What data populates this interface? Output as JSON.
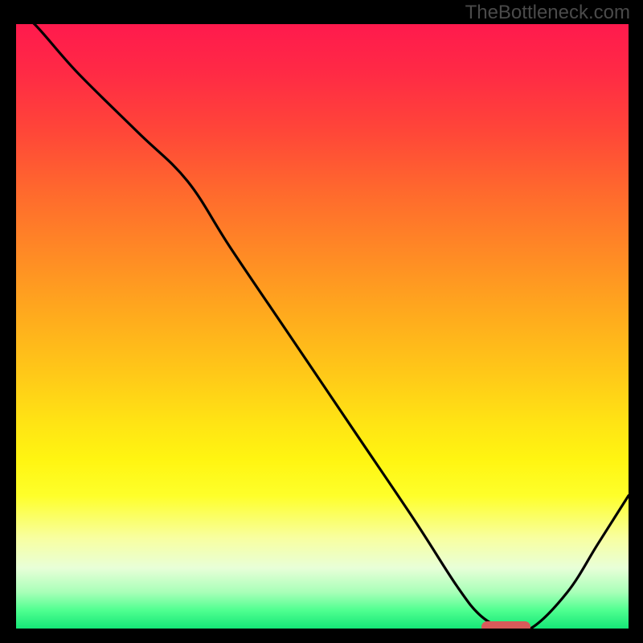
{
  "watermark": "TheBottleneck.com",
  "chart_data": {
    "type": "line",
    "title": "",
    "xlabel": "",
    "ylabel": "",
    "xlim": [
      0,
      100
    ],
    "ylim": [
      0,
      100
    ],
    "x": [
      0,
      3,
      10,
      20,
      28,
      35,
      45,
      55,
      65,
      72,
      76,
      80,
      84,
      90,
      95,
      100
    ],
    "values": [
      102,
      100,
      92,
      82,
      74,
      63,
      48,
      33,
      18,
      7,
      2,
      0,
      0,
      6,
      14,
      22
    ],
    "marker": {
      "x_start": 76,
      "x_end": 84,
      "y": 0
    },
    "gradient_stops": [
      {
        "pos": 0.0,
        "color": "#ff1a4d"
      },
      {
        "pos": 0.5,
        "color": "#ffc918"
      },
      {
        "pos": 0.8,
        "color": "#feff2a"
      },
      {
        "pos": 1.0,
        "color": "#15e777"
      }
    ]
  },
  "colors": {
    "curve": "#000000",
    "marker": "#d85a5a",
    "background": "#000000",
    "watermark": "#4a4a4a"
  }
}
